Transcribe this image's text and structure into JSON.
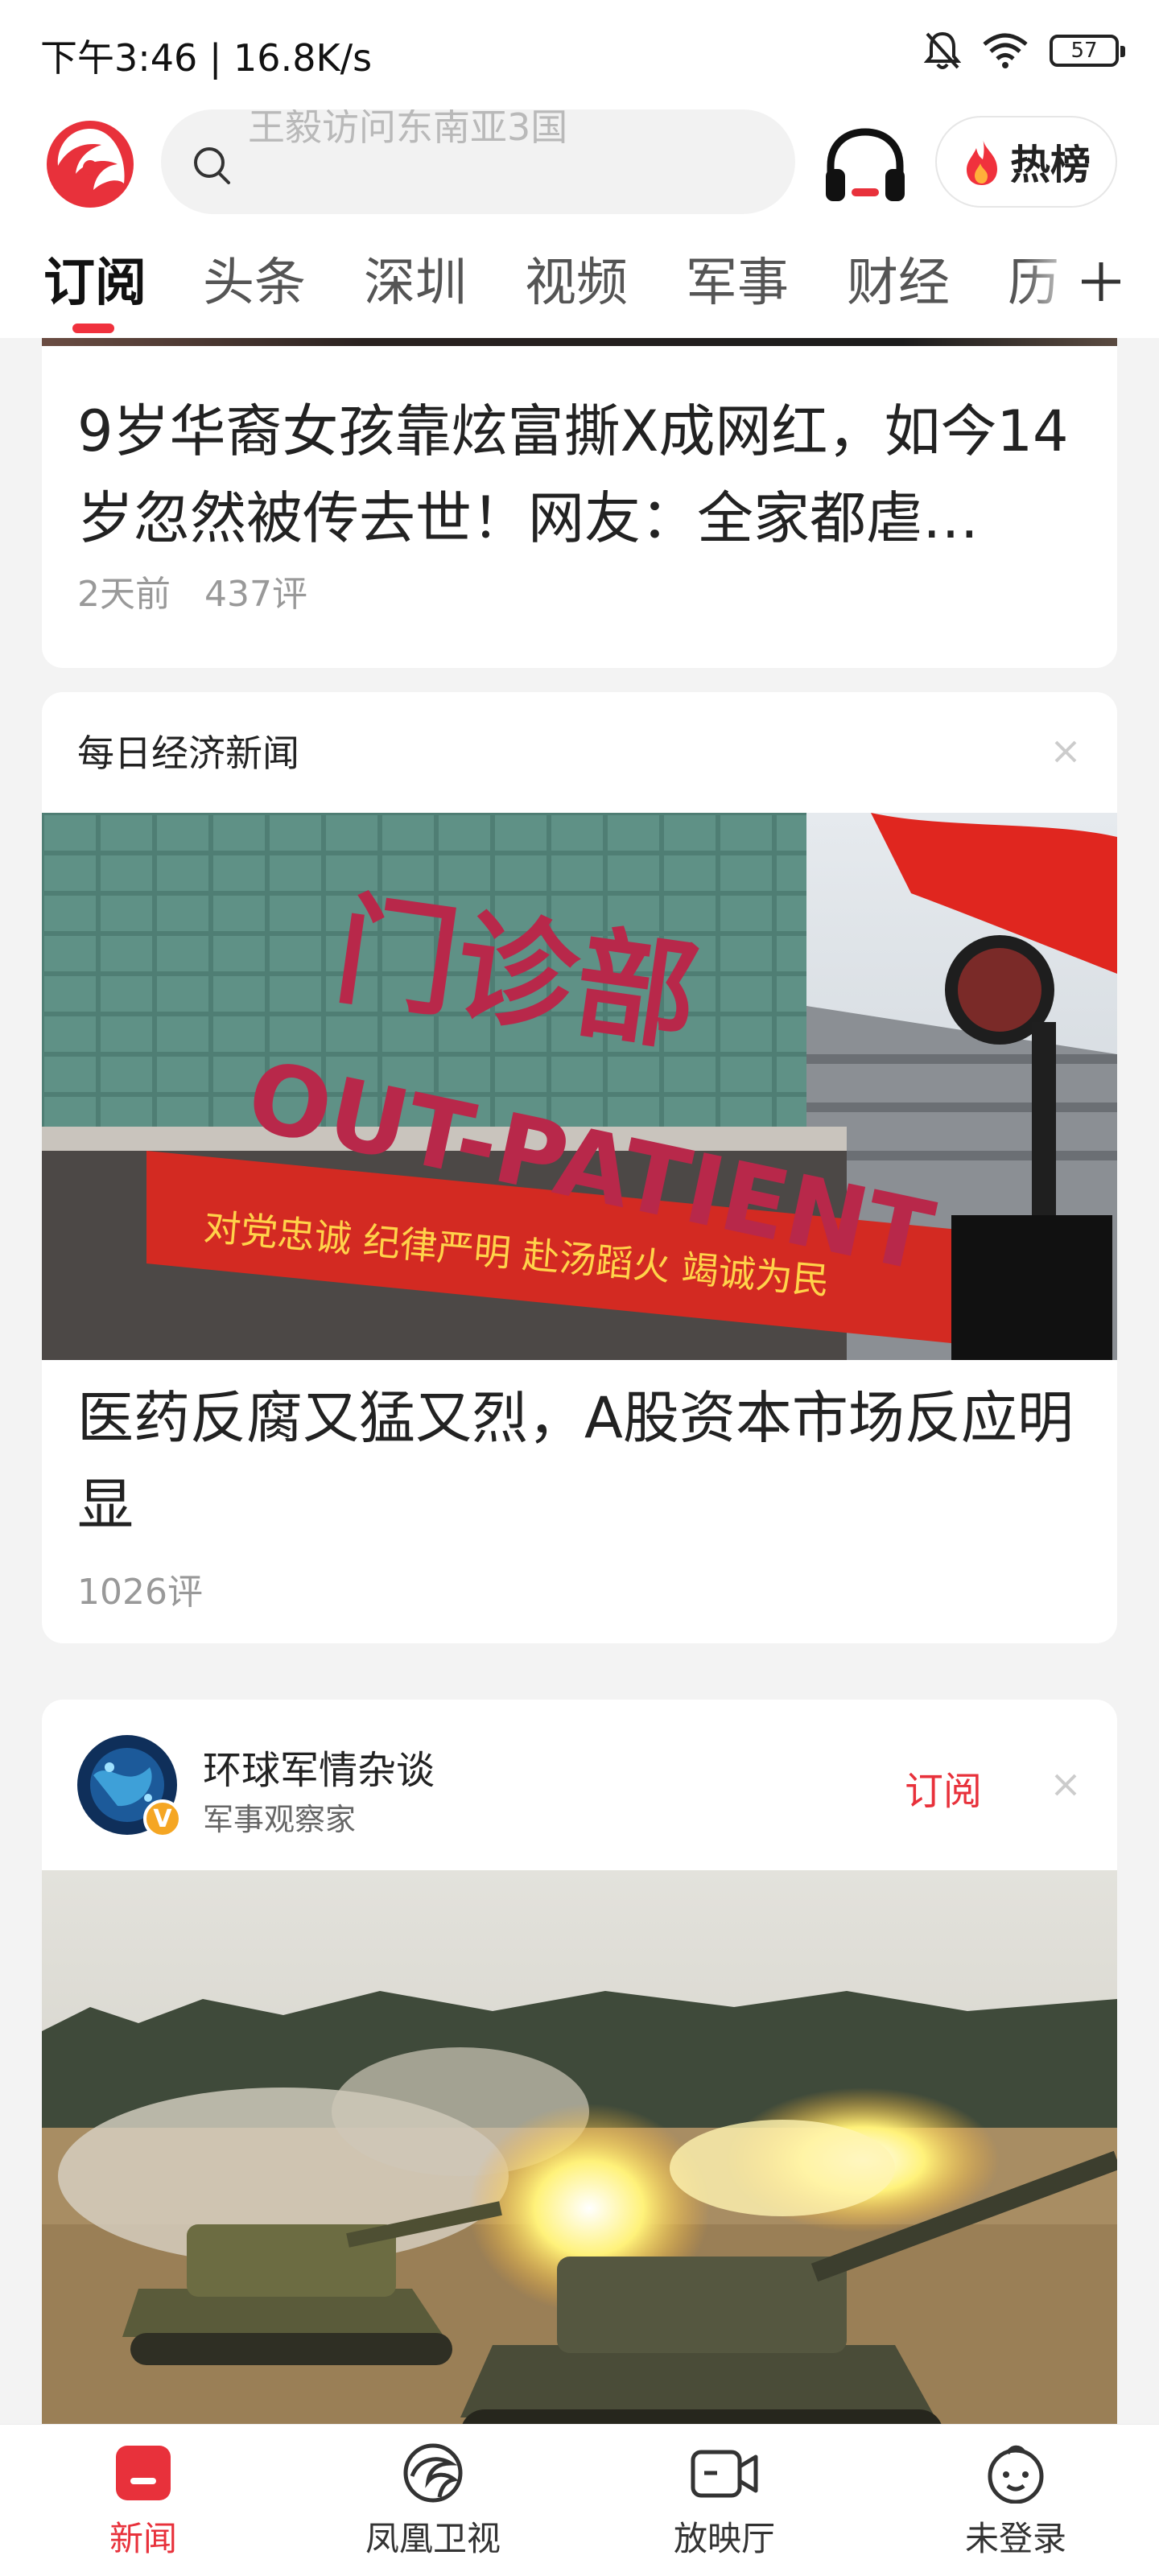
{
  "status_bar": {
    "time_speed": "下午3:46 | 16.8K/s",
    "battery": "57"
  },
  "header": {
    "search_placeholder": "王毅访问东南亚3国",
    "hot_label": "热榜",
    "accent_color": "#e8313b"
  },
  "tabs": [
    {
      "label": "订阅",
      "active": true
    },
    {
      "label": "头条"
    },
    {
      "label": "深圳"
    },
    {
      "label": "视频"
    },
    {
      "label": "军事"
    },
    {
      "label": "财经"
    },
    {
      "label": "历"
    }
  ],
  "feed": [
    {
      "title": "9岁华裔女孩靠炫富撕X成网红，如今14岁忽然被传去世！网友：全家都虐…",
      "time": "2天前",
      "comments": "437评"
    },
    {
      "source": "每日经济新闻",
      "image": {
        "sign_chinese": "门诊部",
        "sign_english": "OUT-PATIENT",
        "banner": "对党忠诚 纪律严明 赴汤蹈火 竭诚为民"
      },
      "title": "医药反腐又猛又烈，A股资本市场反应明显",
      "comments": "1026评"
    },
    {
      "source": "环球军情杂谈",
      "source_desc": "军事观察家",
      "verified_mark": "V",
      "subscribe_label": "订阅"
    }
  ],
  "bottom_nav": [
    {
      "label": "新闻",
      "icon": "news-icon",
      "active": true
    },
    {
      "label": "凤凰卫视",
      "icon": "phoenix-tv-icon"
    },
    {
      "label": "放映厅",
      "icon": "video-camera-icon"
    },
    {
      "label": "未登录",
      "icon": "user-face-icon"
    }
  ]
}
